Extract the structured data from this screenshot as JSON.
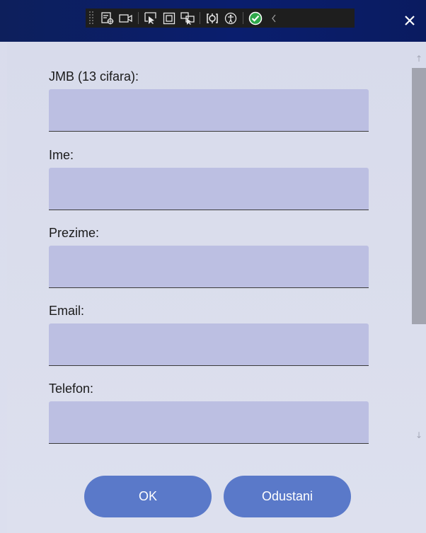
{
  "window": {
    "close_glyph": "✕"
  },
  "toolbar": {
    "icons": [
      "live-visual-tree-icon",
      "video-icon",
      "select-element-icon",
      "display-layout-adorners-icon",
      "track-focus-icon",
      "hot-reload-icon",
      "accessibility-icon",
      "binding-failures-check-icon",
      "collapse-chevron-icon"
    ]
  },
  "form": {
    "fields": [
      {
        "label": "JMB (13 cifara):",
        "value": ""
      },
      {
        "label": "Ime:",
        "value": ""
      },
      {
        "label": "Prezime:",
        "value": ""
      },
      {
        "label": "Email:",
        "value": ""
      },
      {
        "label": "Telefon:",
        "value": ""
      }
    ]
  },
  "buttons": {
    "ok": "OK",
    "cancel": "Odustani"
  },
  "colors": {
    "titlebar": "#0a1e6e",
    "input_bg": "#bcbfe2",
    "button_bg": "#5a79c9",
    "check_green": "#2ea84a"
  }
}
